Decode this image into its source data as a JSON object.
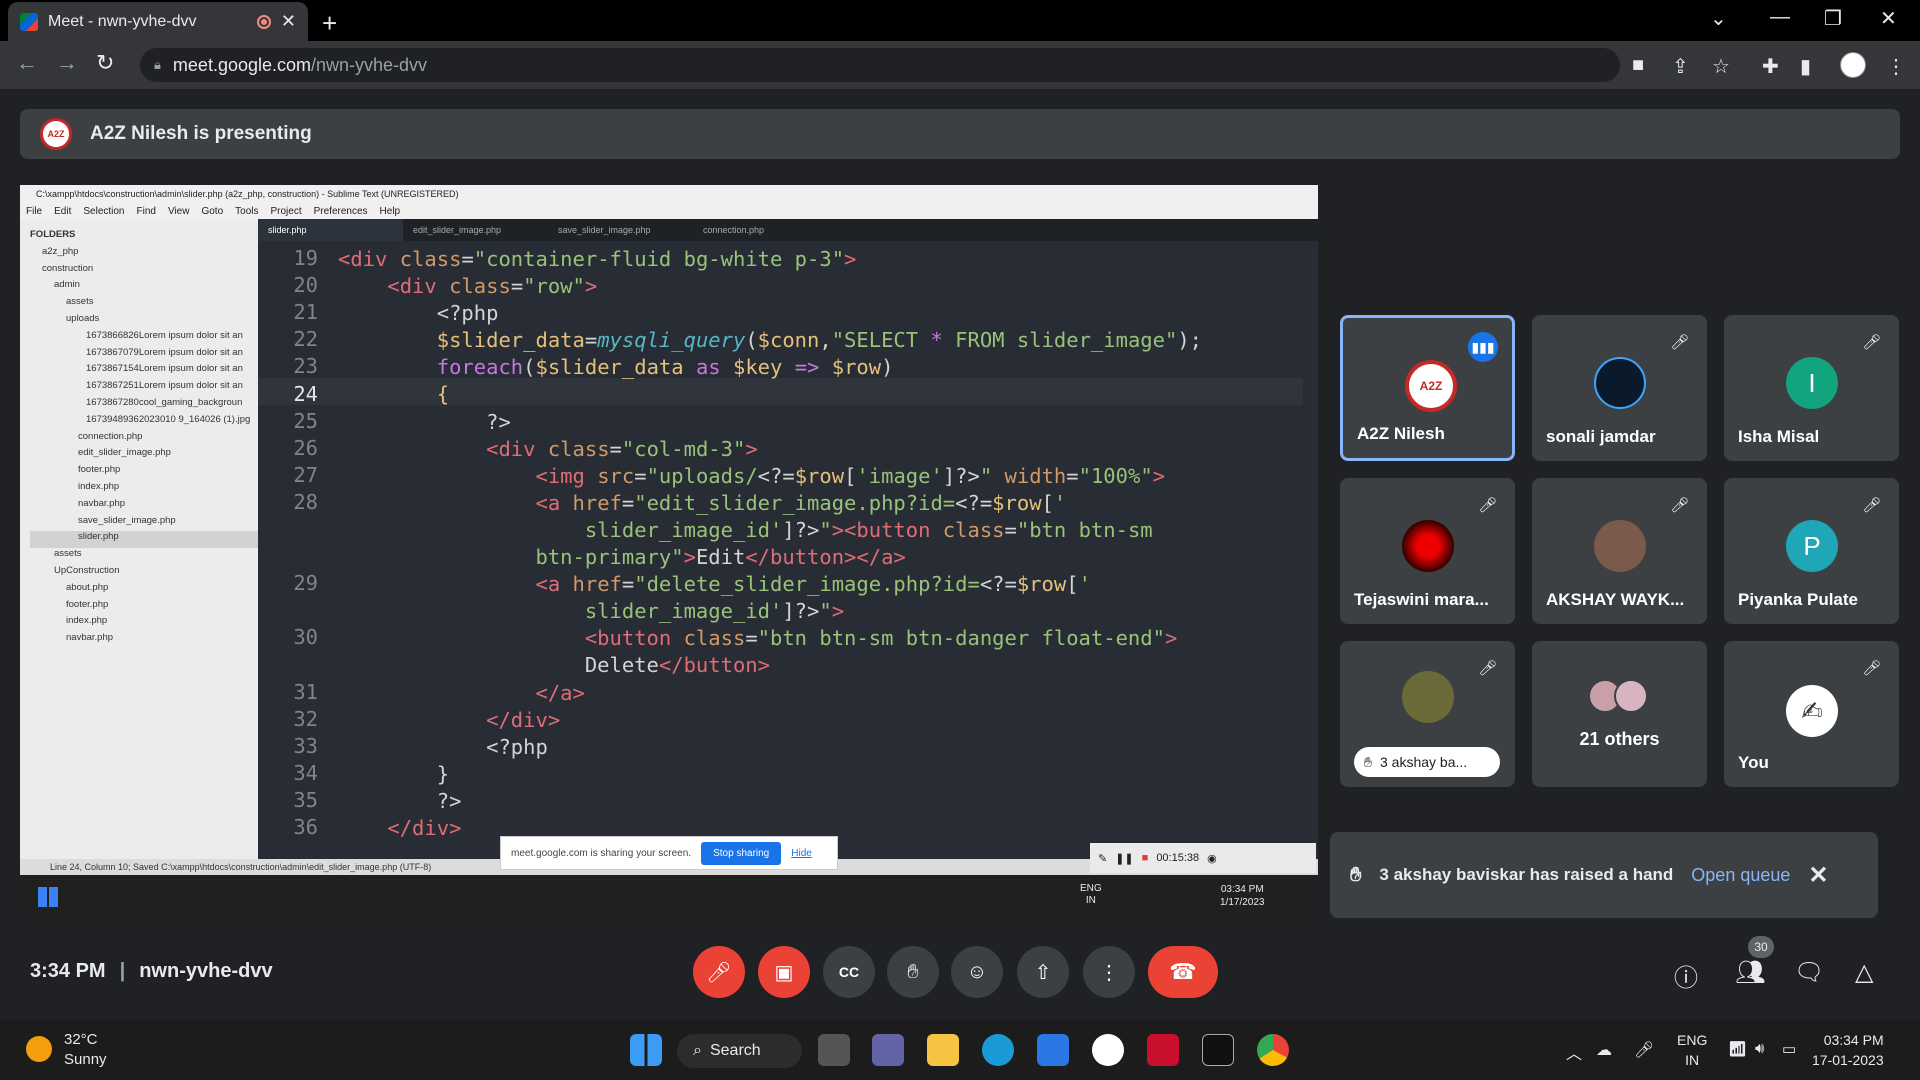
{
  "browser": {
    "tab_title": "Meet - nwn-yvhe-dvv",
    "url_host": "meet.google.com",
    "url_path": "/nwn-yvhe-dvv"
  },
  "presenting_banner": "A2Z Nilesh is presenting",
  "shared_screen": {
    "window_title": "C:\\xampp\\htdocs\\construction\\admin\\slider.php (a2z_php, construction) - Sublime Text (UNREGISTERED)",
    "menu": [
      "File",
      "Edit",
      "Selection",
      "Find",
      "View",
      "Goto",
      "Tools",
      "Project",
      "Preferences",
      "Help"
    ],
    "folders_header": "FOLDERS",
    "tree": [
      "a2z_php",
      "construction",
      "admin",
      "assets",
      "uploads",
      "1673866826Lorem ipsum dolor sit an",
      "1673867079Lorem ipsum dolor sit an",
      "1673867154Lorem ipsum dolor sit an",
      "1673867251Lorem ipsum dolor sit an",
      "1673867280cool_gaming_backgroun",
      "16739489362023010 9_164026 (1).jpg",
      "connection.php",
      "edit_slider_image.php",
      "footer.php",
      "index.php",
      "navbar.php",
      "save_slider_image.php",
      "slider.php",
      "assets",
      "UpConstruction",
      "about.php",
      "footer.php",
      "index.php",
      "navbar.php"
    ],
    "tabs": [
      "slider.php",
      "edit_slider_image.php",
      "save_slider_image.php",
      "connection.php"
    ],
    "line_numbers": [
      "19",
      "20",
      "21",
      "22",
      "23",
      "24",
      "25",
      "26",
      "27",
      "28",
      "",
      "",
      "29",
      "",
      "30",
      "",
      "31",
      "32",
      "33",
      "34",
      "35",
      "36"
    ],
    "status": "Line 24, Column 10; Saved C:\\xampp\\htdocs\\construction\\admin\\edit_slider_image.php (UTF-8)",
    "share_message": "meet.google.com is sharing your screen.",
    "stop_sharing": "Stop sharing",
    "hide": "Hide",
    "rec_time": "00:15:38",
    "inner_clock_time": "03:34 PM",
    "inner_clock_date": "1/17/2023",
    "inner_lang": "ENG",
    "inner_region": "IN"
  },
  "participants": [
    {
      "name": "A2Z Nilesh",
      "color": "#ffffff"
    },
    {
      "name": "sonali jamdar",
      "color": "#0b1a2a"
    },
    {
      "name": "Isha Misal",
      "initial": "I",
      "color": "#12a37f"
    },
    {
      "name": "Tejaswini mara...",
      "color": "#2a0000"
    },
    {
      "name": "AKSHAY WAYK...",
      "color": "#7a5a4a"
    },
    {
      "name": "Piyanka Pulate",
      "initial": "P",
      "color": "#1fa7b7"
    },
    {
      "name": "3 akshay ba...",
      "color": "#6b6b3a"
    },
    {
      "name": "21 others"
    },
    {
      "name": "You",
      "color": "#ffffff"
    }
  ],
  "notification": {
    "text": "3 akshay baviskar has raised a hand",
    "action": "Open queue"
  },
  "meeting_bar": {
    "time": "3:34 PM",
    "code": "nwn-yvhe-dvv",
    "people_count": "30"
  },
  "taskbar": {
    "temp": "32°C",
    "condition": "Sunny",
    "search": "Search",
    "lang": "ENG",
    "region": "IN",
    "time": "03:34 PM",
    "date": "17-01-2023"
  },
  "colors": {
    "accent": "#8ab4f8",
    "danger": "#ea4335",
    "surface": "#3c4043"
  }
}
